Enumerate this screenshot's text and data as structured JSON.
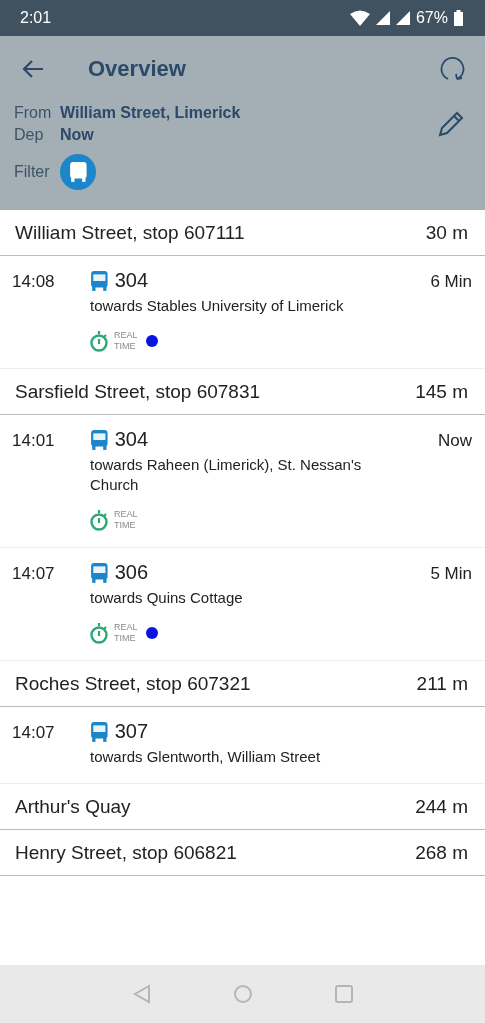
{
  "status_bar": {
    "time": "2:01",
    "battery": "67%"
  },
  "header": {
    "title": "Overview",
    "from_label": "From",
    "from_value": "William Street, Limerick",
    "dep_label": "Dep",
    "dep_value": "Now",
    "filter_label": "Filter",
    "filter_bus_selected": true
  },
  "stops": [
    {
      "name": "William Street, stop 607111",
      "distance": "30 m",
      "departures": [
        {
          "time": "14:08",
          "line": "304",
          "direction": "towards Stables University of Limerick",
          "countdown": "6 Min",
          "realtime": {
            "label": "REAL TIME",
            "dot": true
          }
        }
      ]
    },
    {
      "name": "Sarsfield Street, stop 607831",
      "distance": "145 m",
      "departures": [
        {
          "time": "14:01",
          "line": "304",
          "direction": "towards Raheen (Limerick), St. Nessan's Church",
          "countdown": "Now",
          "realtime": {
            "label": "REAL TIME",
            "dot": false
          }
        },
        {
          "time": "14:07",
          "line": "306",
          "direction": "towards Quins Cottage",
          "countdown": "5 Min",
          "realtime": {
            "label": "REAL TIME",
            "dot": true
          }
        }
      ]
    },
    {
      "name": "Roches Street, stop 607321",
      "distance": "211 m",
      "departures": [
        {
          "time": "14:07",
          "line": "307",
          "direction": "towards Glentworth, William Street"
        }
      ]
    },
    {
      "name": "Arthur's Quay",
      "distance": "244 m"
    },
    {
      "name": "Henry Street, stop 606821",
      "distance": "268 m"
    }
  ]
}
